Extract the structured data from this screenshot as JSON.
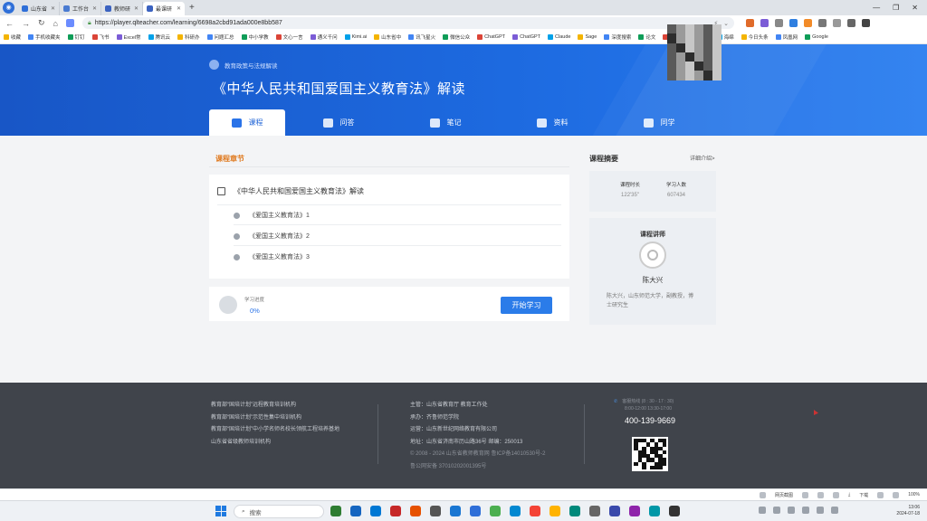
{
  "browser": {
    "tabs": [
      {
        "label": "山东省",
        "color": "#2f6fd8"
      },
      {
        "label": "工作台",
        "color": "#4a7bd1"
      },
      {
        "label": "教师研",
        "color": "#3b62c0"
      },
      {
        "label": "最课研",
        "color": "#3b62c0",
        "active": true
      }
    ],
    "url": "https://player.qlteacher.com/learning/6698a2cbd91ada000e8bb587",
    "bookmarks": [
      "收藏",
      "手机收藏夹",
      "钉钉",
      "飞书",
      "Excel常",
      "腾讯云",
      "科研办",
      "问题汇总",
      "中小学教",
      "文心一言",
      "通义千问",
      "Kimi.ai",
      "山东省中",
      "讯飞星火",
      "微信公众",
      "ChatGPT",
      "ChatGPT",
      "Claude",
      "Sage",
      "深度搜索",
      "论文",
      "秘塔AI",
      "宝藏",
      "海绵",
      "今日头条",
      "凤凰网",
      "Google"
    ]
  },
  "header": {
    "breadcrumb": "教育政策与法规解读",
    "title": "《中华人民共和国爱国主义教育法》解读",
    "tabs": [
      {
        "label": "课程",
        "active": true
      },
      {
        "label": "问答"
      },
      {
        "label": "笔记"
      },
      {
        "label": "资料"
      },
      {
        "label": "同学"
      }
    ]
  },
  "chapters": {
    "title": "课程章节",
    "section": "《中华人民共和国爱国主义教育法》解读",
    "lessons": [
      "《爱国主义教育法》1",
      "《爱国主义教育法》2",
      "《爱国主义教育法》3"
    ]
  },
  "progress": {
    "label": "学习进度",
    "value": "0%",
    "button": "开始学习"
  },
  "summary": {
    "title": "课程摘要",
    "detail_link": "详细介绍>",
    "stats": [
      {
        "label": "课程时长",
        "value": "122'35\""
      },
      {
        "label": "学习人数",
        "value": "607434"
      }
    ]
  },
  "teacher": {
    "title": "课程讲师",
    "name": "陈大兴",
    "desc": "陈大兴，山东师范大学，副教授，博士研究生"
  },
  "footer": {
    "col1": [
      "教育部“国培计划”远程教育培训机构",
      "教育部“国培计划”示范性集中培训机构",
      "教育部“国培计划”中小学名师名校长领航工程培养基地",
      "山东省省级教师培训机构"
    ],
    "col2": [
      "主管：山东省教育厅 教育工作处",
      "承办：齐鲁师范学院",
      "运营：山东新世纪网络教育有限公司",
      "地址：山东省济南市历山路36号    邮编：250013",
      "© 2008 - 2024 山东省教师教育网 鲁ICP备14010530号-2",
      "鲁公网安备 37010202001395号"
    ],
    "hours_label": "客服热线 (8 : 30 - 17 : 30)",
    "hours": "8:00-12:00  13:30-17:00",
    "phone": "400-139-9669"
  },
  "strip": [
    "网页截图",
    "下载"
  ],
  "strip_zoom": "100%",
  "taskbar": {
    "search": "搜索",
    "time": "13:06",
    "date": "2024-07-18"
  }
}
